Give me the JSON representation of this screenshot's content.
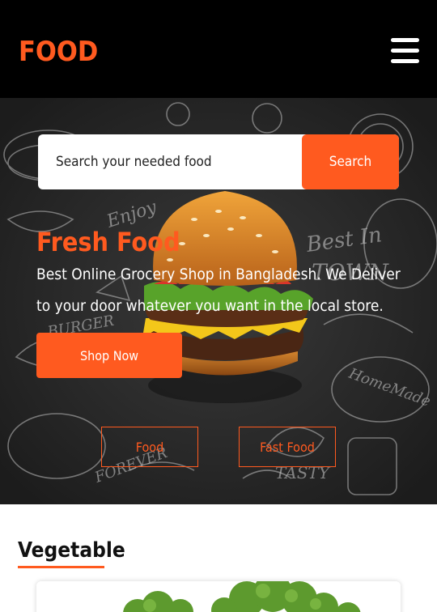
{
  "header": {
    "logo": "FOOD",
    "menu_icon": "hamburger-menu-icon"
  },
  "hero": {
    "search": {
      "placeholder": "Search your needed food",
      "button_label": "Search"
    },
    "title": "Fresh Food",
    "description": "Best Online Grocery Shop in Bangladesh. We Deliver to your door whatever you want in the local store.",
    "shop_button": "Shop Now",
    "categories": [
      "Food",
      "Fast Food"
    ]
  },
  "section": {
    "title": "Vegetable"
  },
  "colors": {
    "accent": "#ff5a1f",
    "navbar": "#000000",
    "hero_background": "#262626"
  }
}
